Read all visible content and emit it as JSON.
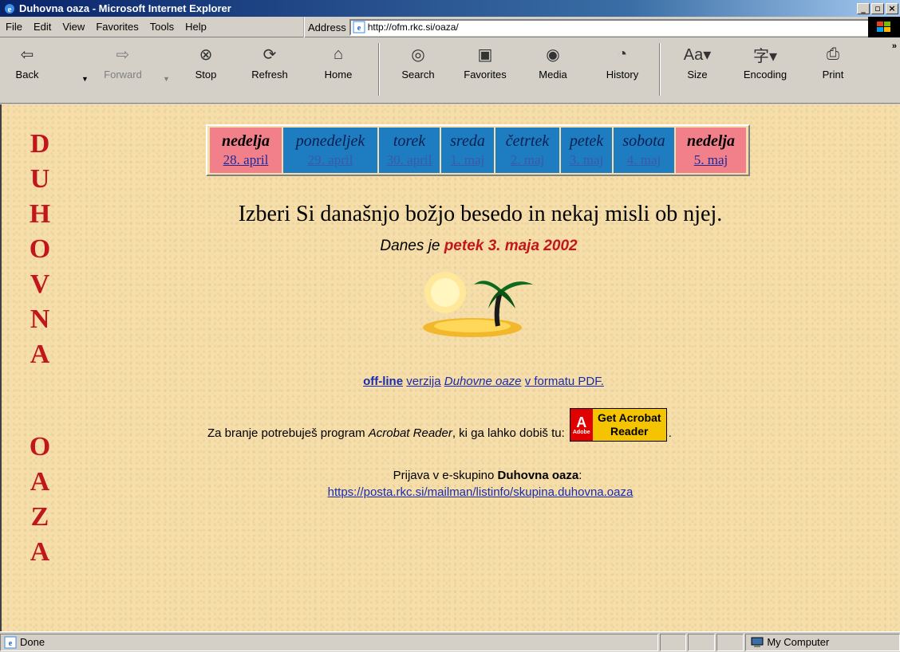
{
  "window": {
    "title": "Duhovna oaza - Microsoft Internet Explorer"
  },
  "menu": {
    "items": [
      "File",
      "Edit",
      "View",
      "Favorites",
      "Tools",
      "Help"
    ],
    "address_label": "Address",
    "url": "http://ofm.rkc.si/oaza/"
  },
  "toolbar": {
    "back": "Back",
    "forward": "Forward",
    "stop": "Stop",
    "refresh": "Refresh",
    "home": "Home",
    "search": "Search",
    "favorites": "Favorites",
    "media": "Media",
    "history": "History",
    "size": "Size",
    "encoding": "Encoding",
    "print": "Print"
  },
  "sidebar": {
    "letters": [
      "D",
      "U",
      "H",
      "O",
      "V",
      "N",
      "A",
      "O",
      "A",
      "Z",
      "A"
    ]
  },
  "days": [
    {
      "name": "nedelja",
      "date": "28. april",
      "type": "sun"
    },
    {
      "name": "ponedeljek",
      "date": "29. april",
      "type": "week"
    },
    {
      "name": "torek",
      "date": "30. april",
      "type": "week"
    },
    {
      "name": "sreda",
      "date": "1. maj",
      "type": "week"
    },
    {
      "name": "četrtek",
      "date": "2. maj",
      "type": "week"
    },
    {
      "name": "petek",
      "date": "3. maj",
      "type": "week"
    },
    {
      "name": "sobota",
      "date": "4. maj",
      "type": "week"
    },
    {
      "name": "nedelja",
      "date": "5. maj",
      "type": "sun"
    }
  ],
  "main": {
    "headline": "Izberi Si današnjo božjo besedo in nekaj misli ob njej.",
    "today_prefix": "Danes je",
    "today_date": "petek 3. maja 2002",
    "pdf_bold": "off-line",
    "pdf_text1": "verzija",
    "pdf_italic": "Duhovne oaze",
    "pdf_text2": "v formatu PDF.",
    "acrobat_prefix": "Za branje potrebuješ program",
    "acrobat_name": "Acrobat Reader",
    "acrobat_suffix": ", ki ga lahko dobiš tu:",
    "acrobat_badge_line1": "Get Acrobat",
    "acrobat_badge_line2": "Reader",
    "acrobat_logo_text": "Adobe",
    "join_prefix": "Prijava v e-skupino",
    "join_name": "Duhovna oaza",
    "join_suffix": ":",
    "join_link": "https://posta.rkc.si/mailman/listinfo/skupina.duhovna.oaza"
  },
  "status": {
    "text": "Done",
    "zone": "My Computer"
  }
}
